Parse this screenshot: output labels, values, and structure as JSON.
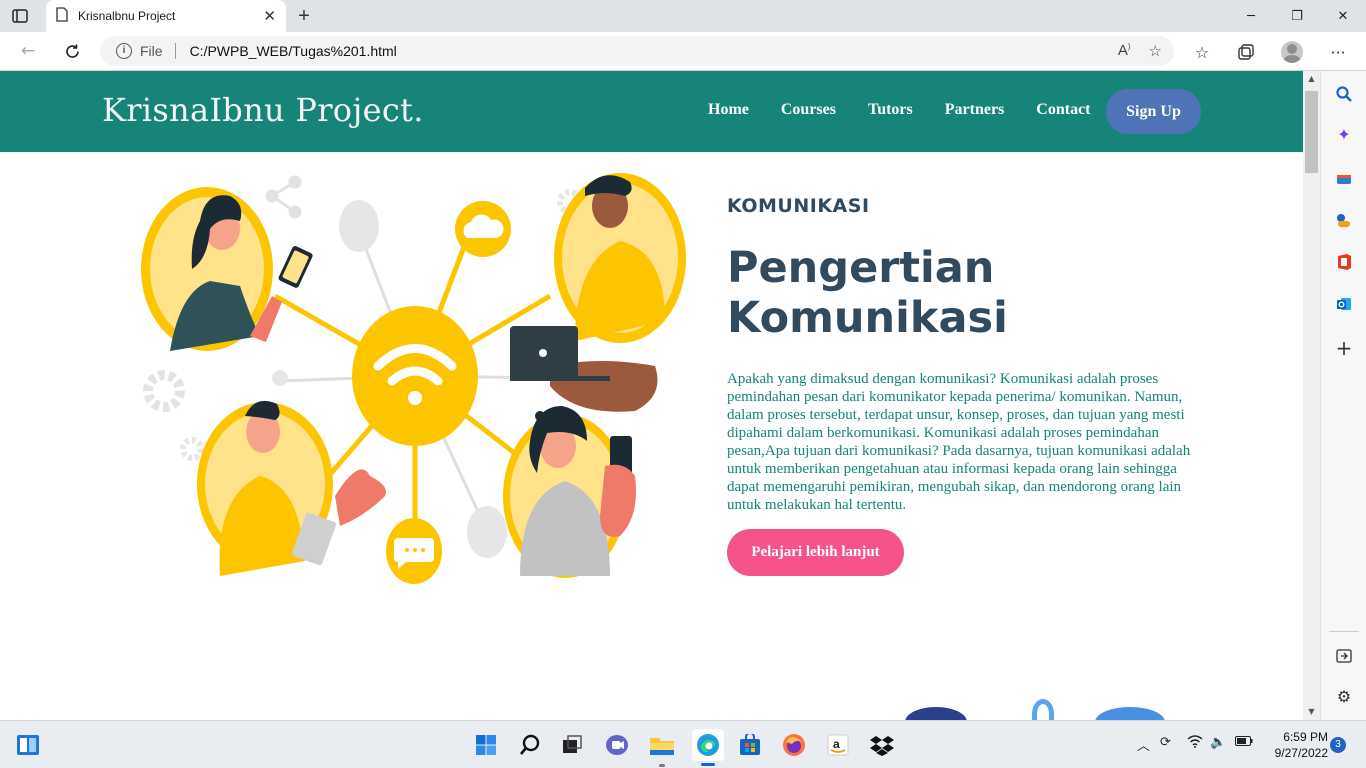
{
  "browser": {
    "tab_title": "Krisnalbnu Project",
    "tab_close": "✕",
    "new_tab": "+",
    "address_scheme_label": "File",
    "address_url": "C:/PWPB_WEB/Tugas%201.html",
    "window_controls": [
      "─",
      "❐",
      "✕"
    ]
  },
  "site": {
    "brand": "KrisnaIbnu Project.",
    "nav": [
      "Home",
      "Courses",
      "Tutors",
      "Partners",
      "Contact"
    ],
    "signup": "Sign Up",
    "kicker": "KOMUNIKASI",
    "headline_line1": "Pengertian",
    "headline_line2": "Komunikasi",
    "paragraph": "Apakah yang dimaksud dengan komunikasi? Komunikasi adalah proses pemindahan pesan dari komunikator kepada penerima/ komunikan. Namun, dalam proses tersebut, terdapat unsur, konsep, proses, dan tujuan yang mesti dipahami dalam berkomunikasi. Komunikasi adalah proses pemindahan pesan,Apa tujuan dari komunikasi? Pada dasarnya, tujuan komunikasi adalah untuk memberikan pengetahuan atau informasi kepada orang lain sehingga dapat memengaruhi pemikiran, mengubah sikap, dan mendorong orang lain untuk melakukan hal tertentu.",
    "cta": "Pelajari lebih lanjut",
    "colors": {
      "nav_bg": "#178479",
      "signup_bg": "#4e73b7",
      "heading": "#324a5e",
      "paragraph": "#178479",
      "cta_bg": "#f4548a",
      "illustration_yellow": "#fdc500"
    }
  },
  "taskbar": {
    "time": "6:59 PM",
    "date": "9/27/2022",
    "notification_count": "3"
  }
}
